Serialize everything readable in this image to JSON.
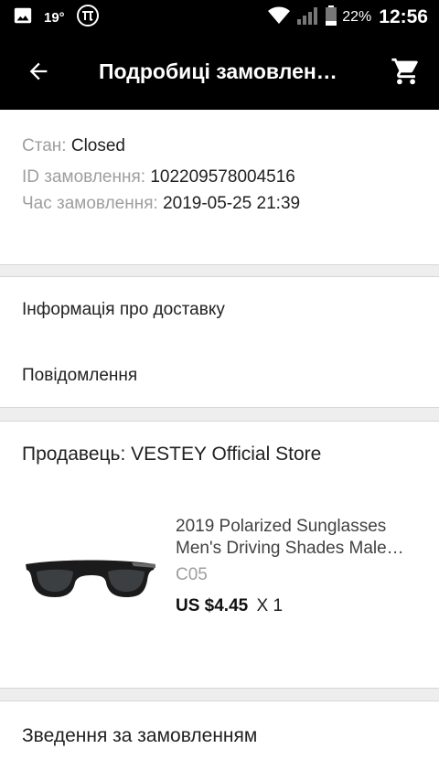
{
  "status_bar": {
    "temperature": "19°",
    "battery_pct": "22%",
    "time": "12:56",
    "icons": [
      "image-icon",
      "pi-icon",
      "wifi-icon",
      "signal-icon",
      "battery-icon"
    ]
  },
  "app_bar": {
    "title": "Подробиці замовлен…",
    "back_icon": "arrow-left-icon",
    "cart_icon": "shopping-cart-icon"
  },
  "order_meta": {
    "status_label": "Стан:",
    "status_value": "Closed",
    "id_label": "ID замовлення:",
    "id_value": "102209578004516",
    "time_label": "Час замовлення:",
    "time_value": "2019-05-25 21:39"
  },
  "links": {
    "delivery": "Інформація про доставку",
    "messages": "Повідомлення"
  },
  "seller": {
    "title": "Продавець: VESTEY Official Store"
  },
  "product": {
    "title_line1": "2019 Polarized Sunglasses",
    "title_line2": "Men's Driving Shades Male…",
    "sku": "C05",
    "price": "US $4.45",
    "qty": "X 1"
  },
  "summary": {
    "title": "Зведення за замовленням"
  },
  "colors": {
    "app_bar_bg": "#000000",
    "page_bg": "#eeeeee",
    "label_gray": "#9e9e9e"
  }
}
